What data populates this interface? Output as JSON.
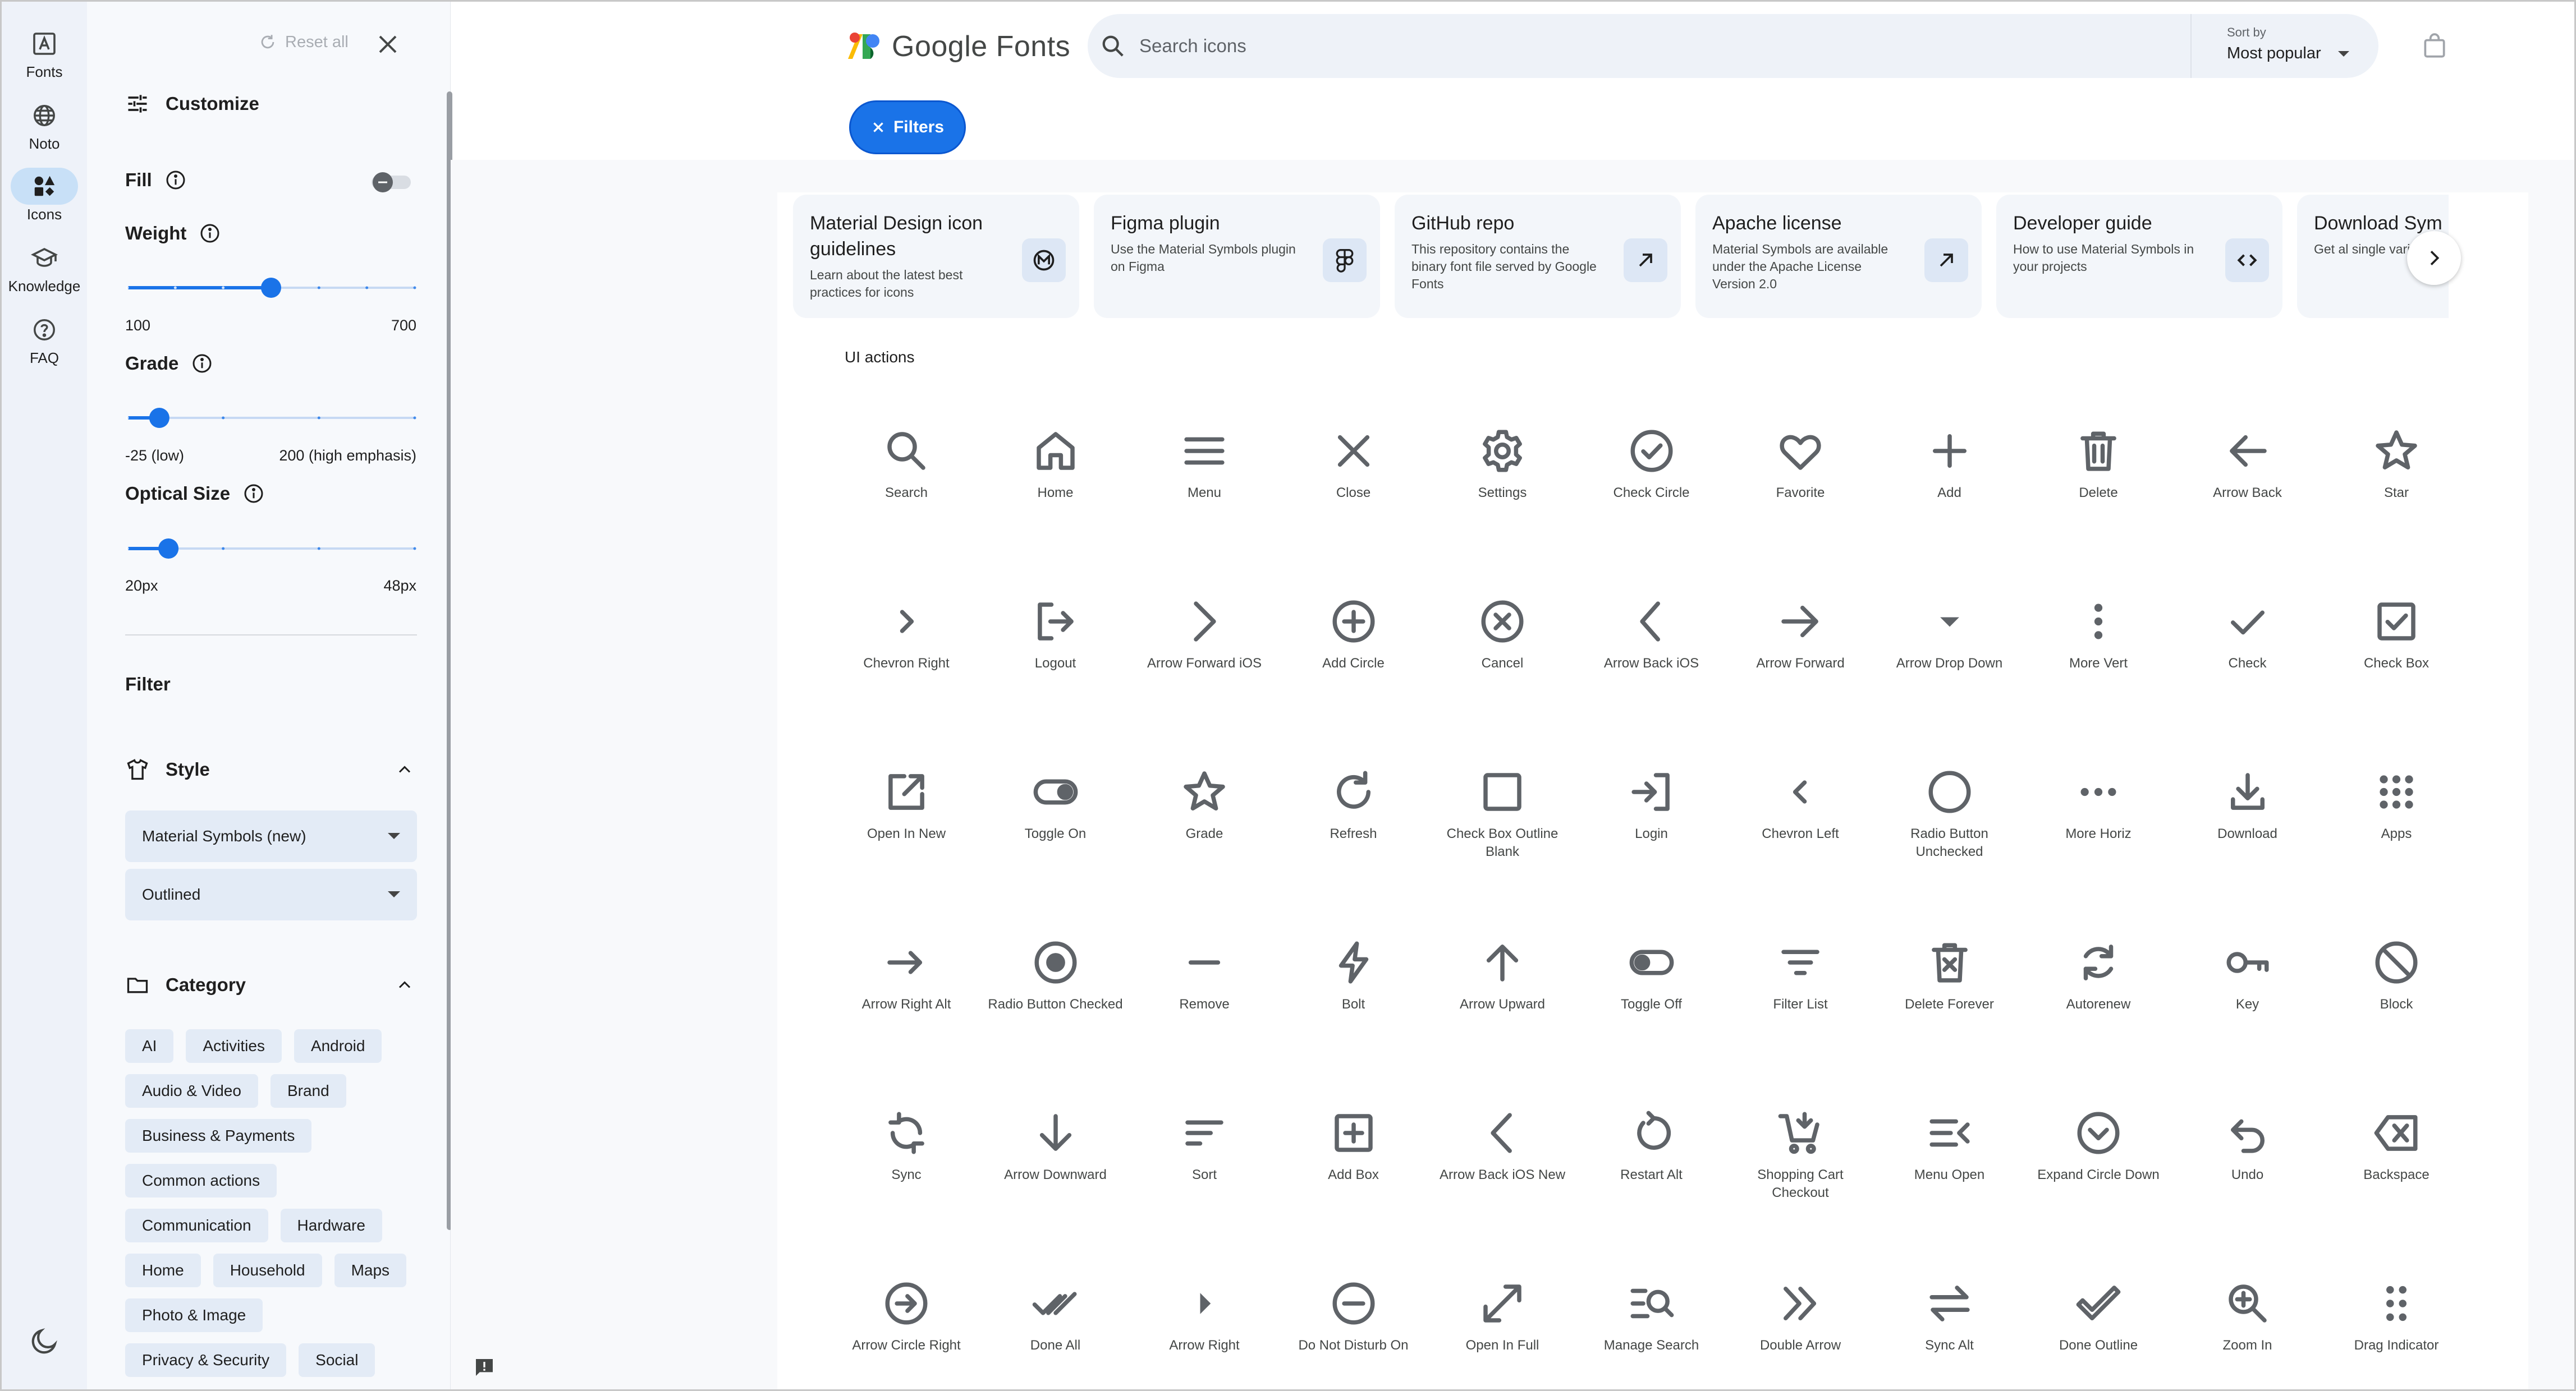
{
  "rail": {
    "items": [
      {
        "label": "Fonts",
        "icon": "font-icon"
      },
      {
        "label": "Noto",
        "icon": "globe-icon"
      },
      {
        "label": "Icons",
        "icon": "shapes-icon",
        "active": true
      },
      {
        "label": "Knowledge",
        "icon": "school-icon"
      },
      {
        "label": "FAQ",
        "icon": "help-icon"
      }
    ]
  },
  "panel": {
    "reset_label": "Reset all",
    "customize_title": "Customize",
    "fill_label": "Fill",
    "weight_label": "Weight",
    "weight_min": "100",
    "weight_max": "700",
    "weight_value": 400,
    "grade_label": "Grade",
    "grade_min": "-25 (low)",
    "grade_max": "200 (high emphasis)",
    "grade_value": 0,
    "optical_label": "Optical Size",
    "optical_min": "20px",
    "optical_max": "48px",
    "optical_value": 24,
    "filter_title": "Filter",
    "style_title": "Style",
    "style_family": "Material Symbols (new)",
    "style_variant": "Outlined",
    "category_title": "Category",
    "categories": [
      "AI",
      "Activities",
      "Android",
      "Audio & Video",
      "Brand",
      "Business & Payments",
      "Common actions",
      "Communication",
      "Hardware",
      "Home",
      "Household",
      "Maps",
      "Photo & Image",
      "Privacy & Security",
      "Social"
    ]
  },
  "header": {
    "logo_text": "Google Fonts",
    "search_placeholder": "Search icons",
    "sort_label": "Sort by",
    "sort_value": "Most popular",
    "filters_button": "Filters"
  },
  "cards": [
    {
      "title": "Material Design icon guidelines",
      "desc": "Learn about the latest best practices for icons",
      "icon": "material-logo-icon"
    },
    {
      "title": "Figma plugin",
      "desc": "Use the Material Symbols plugin on Figma",
      "icon": "figma-icon"
    },
    {
      "title": "GitHub repo",
      "desc": "This repository contains the binary font file served by Google Fonts",
      "icon": "arrow-outward-icon"
    },
    {
      "title": "Apache license",
      "desc": "Material Symbols are available under the Apache License Version 2.0",
      "icon": "arrow-outward-icon"
    },
    {
      "title": "Developer guide",
      "desc": "How to use Material Symbols in your projects",
      "icon": "code-icon"
    },
    {
      "title": "Download Sym",
      "desc": "Get al single varia",
      "icon": "download-icon"
    }
  ],
  "group_title": "UI actions",
  "icons": [
    [
      "Search",
      "search"
    ],
    [
      "Home",
      "home"
    ],
    [
      "Menu",
      "menu"
    ],
    [
      "Close",
      "close"
    ],
    [
      "Settings",
      "settings"
    ],
    [
      "Check Circle",
      "check_circle"
    ],
    [
      "Favorite",
      "favorite"
    ],
    [
      "Add",
      "add"
    ],
    [
      "Delete",
      "delete"
    ],
    [
      "Arrow Back",
      "arrow_back"
    ],
    [
      "Star",
      "star"
    ],
    [
      "Chevron Right",
      "chevron_right"
    ],
    [
      "Logout",
      "logout"
    ],
    [
      "Arrow Forward iOS",
      "arrow_forward_ios"
    ],
    [
      "Add Circle",
      "add_circle"
    ],
    [
      "Cancel",
      "cancel"
    ],
    [
      "Arrow Back iOS",
      "arrow_back_ios"
    ],
    [
      "Arrow Forward",
      "arrow_forward"
    ],
    [
      "Arrow Drop Down",
      "arrow_drop_down"
    ],
    [
      "More Vert",
      "more_vert"
    ],
    [
      "Check",
      "check"
    ],
    [
      "Check Box",
      "check_box"
    ],
    [
      "Open In New",
      "open_in_new"
    ],
    [
      "Toggle On",
      "toggle_on"
    ],
    [
      "Grade",
      "grade"
    ],
    [
      "Refresh",
      "refresh"
    ],
    [
      "Check Box Outline Blank",
      "check_box_outline_blank"
    ],
    [
      "Login",
      "login"
    ],
    [
      "Chevron Left",
      "chevron_left"
    ],
    [
      "Radio Button Unchecked",
      "radio_button_unchecked"
    ],
    [
      "More Horiz",
      "more_horiz"
    ],
    [
      "Download",
      "download"
    ],
    [
      "Apps",
      "apps"
    ],
    [
      "Arrow Right Alt",
      "arrow_right_alt"
    ],
    [
      "Radio Button Checked",
      "radio_button_checked"
    ],
    [
      "Remove",
      "remove"
    ],
    [
      "Bolt",
      "bolt"
    ],
    [
      "Arrow Upward",
      "arrow_upward"
    ],
    [
      "Toggle Off",
      "toggle_off"
    ],
    [
      "Filter List",
      "filter_list"
    ],
    [
      "Delete Forever",
      "delete_forever"
    ],
    [
      "Autorenew",
      "autorenew"
    ],
    [
      "Key",
      "key"
    ],
    [
      "Block",
      "block"
    ],
    [
      "Sync",
      "sync"
    ],
    [
      "Arrow Downward",
      "arrow_downward"
    ],
    [
      "Sort",
      "sort"
    ],
    [
      "Add Box",
      "add_box"
    ],
    [
      "Arrow Back iOS New",
      "arrow_back_ios_new"
    ],
    [
      "Restart Alt",
      "restart_alt"
    ],
    [
      "Shopping Cart Checkout",
      "shopping_cart_checkout"
    ],
    [
      "Menu Open",
      "menu_open"
    ],
    [
      "Expand Circle Down",
      "expand_circle_down"
    ],
    [
      "Undo",
      "undo"
    ],
    [
      "Backspace",
      "backspace"
    ],
    [
      "Arrow Circle Right",
      "arrow_circle_right"
    ],
    [
      "Done All",
      "done_all"
    ],
    [
      "Arrow Right",
      "arrow_right"
    ],
    [
      "Do Not Disturb On",
      "do_not_disturb_on"
    ],
    [
      "Open In Full",
      "open_in_full"
    ],
    [
      "Manage Search",
      "manage_search"
    ],
    [
      "Double Arrow",
      "double_arrow"
    ],
    [
      "Sync Alt",
      "sync_alt"
    ],
    [
      "Done Outline",
      "done_outline"
    ],
    [
      "Zoom In",
      "zoom_in"
    ],
    [
      "Drag Indicator",
      "drag_indicator"
    ]
  ],
  "colors": {
    "accent": "#1a73e8",
    "icon": "#5f6368",
    "rail_bg": "#eef2f9",
    "panel_bg": "#f7f9fc",
    "chip_bg": "#e3ebf6"
  }
}
